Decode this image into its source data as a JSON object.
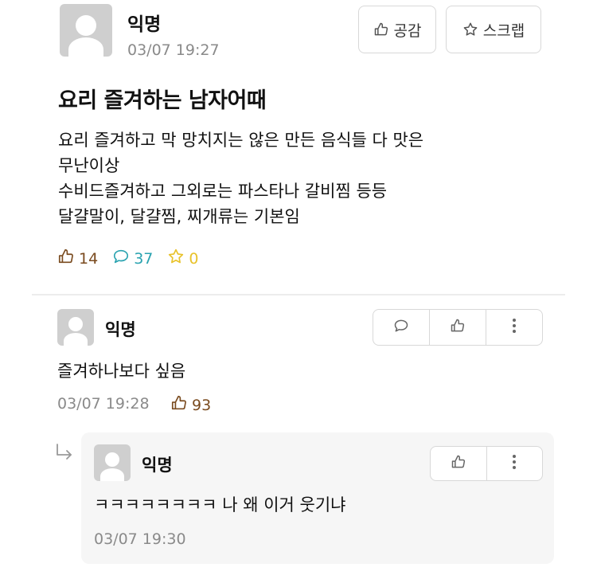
{
  "post": {
    "author": "익명",
    "timestamp": "03/07 19:27",
    "like_button_label": "공감",
    "scrap_button_label": "스크랩",
    "title": "요리 즐겨하는 남자어때",
    "body_lines": [
      "요리 즐겨하고 막 망치지는 않은 만든 음식들 다 맛은",
      "무난이상",
      "수비드즐겨하고 그외로는 파스타나 갈비찜 등등",
      "달걀말이, 달걀찜, 찌개류는 기본임"
    ],
    "like_count": "14",
    "comment_count": "37",
    "scrap_count": "0"
  },
  "comments": [
    {
      "author": "익명",
      "text": "즐겨하나보다 싶음",
      "timestamp": "03/07 19:28",
      "like_count": "93"
    }
  ],
  "replies": [
    {
      "author": "익명",
      "text": "ㅋㅋㅋㅋㅋㅋㅋㅋ 나 왜 이거 웃기냐",
      "timestamp": "03/07 19:30"
    }
  ],
  "colors": {
    "like": "#7a4b1f",
    "comment": "#2aa3b0",
    "scrap": "#e8c22a",
    "meta": "#8a8a8a"
  }
}
